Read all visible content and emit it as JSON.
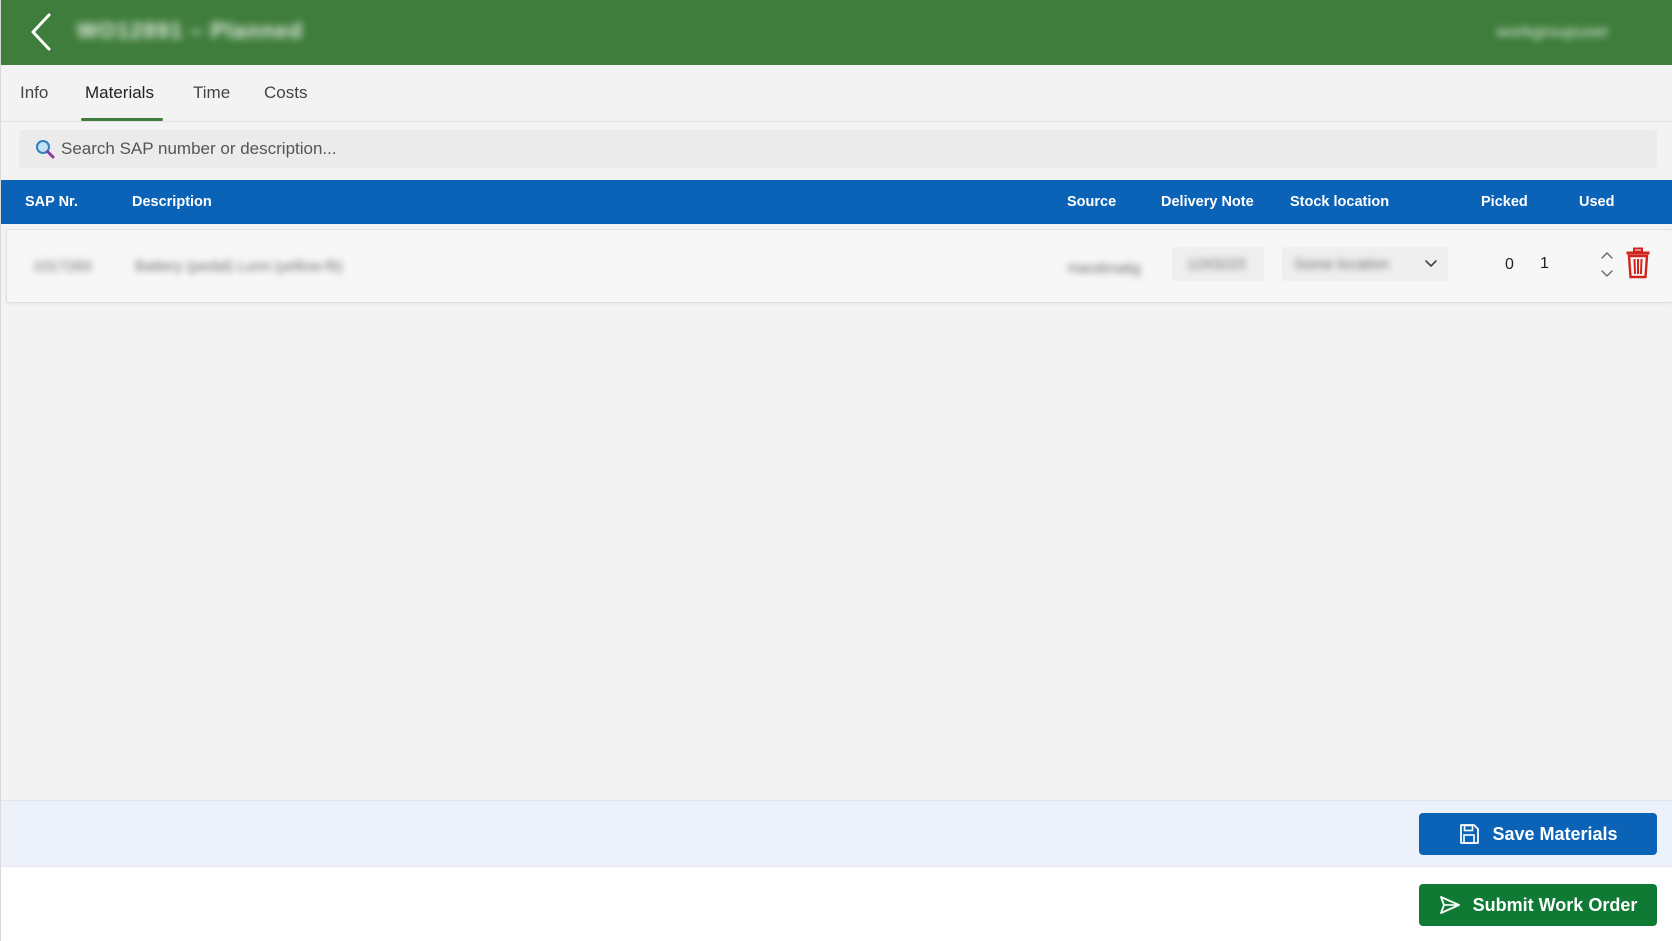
{
  "header": {
    "title": "WO12891 – Planned",
    "user": "workgroupuser"
  },
  "tabs": [
    {
      "label": "Info"
    },
    {
      "label": "Materials"
    },
    {
      "label": "Time"
    },
    {
      "label": "Costs"
    }
  ],
  "active_tab": "Materials",
  "search": {
    "placeholder": "Search SAP number or description..."
  },
  "table": {
    "columns": [
      "SAP Nr.",
      "Description",
      "Source",
      "Delivery Note",
      "Stock location",
      "Picked",
      "Used"
    ],
    "rows": [
      {
        "sap_nr": "1017283",
        "description": "Battery (pedal) Lumi (yellow-fit)",
        "source": "Handmatig",
        "delivery_note": "1243223",
        "stock_location": "Some location",
        "picked": "0",
        "used": "1"
      }
    ]
  },
  "actions": {
    "save_label": "Save Materials",
    "submit_label": "Submit Work Order"
  },
  "colors": {
    "header": "#3f7d3c",
    "table_header": "#0b63b8",
    "save_button": "#0b63b8",
    "submit_button": "#0e7a33",
    "delete_icon": "#d0241d"
  }
}
